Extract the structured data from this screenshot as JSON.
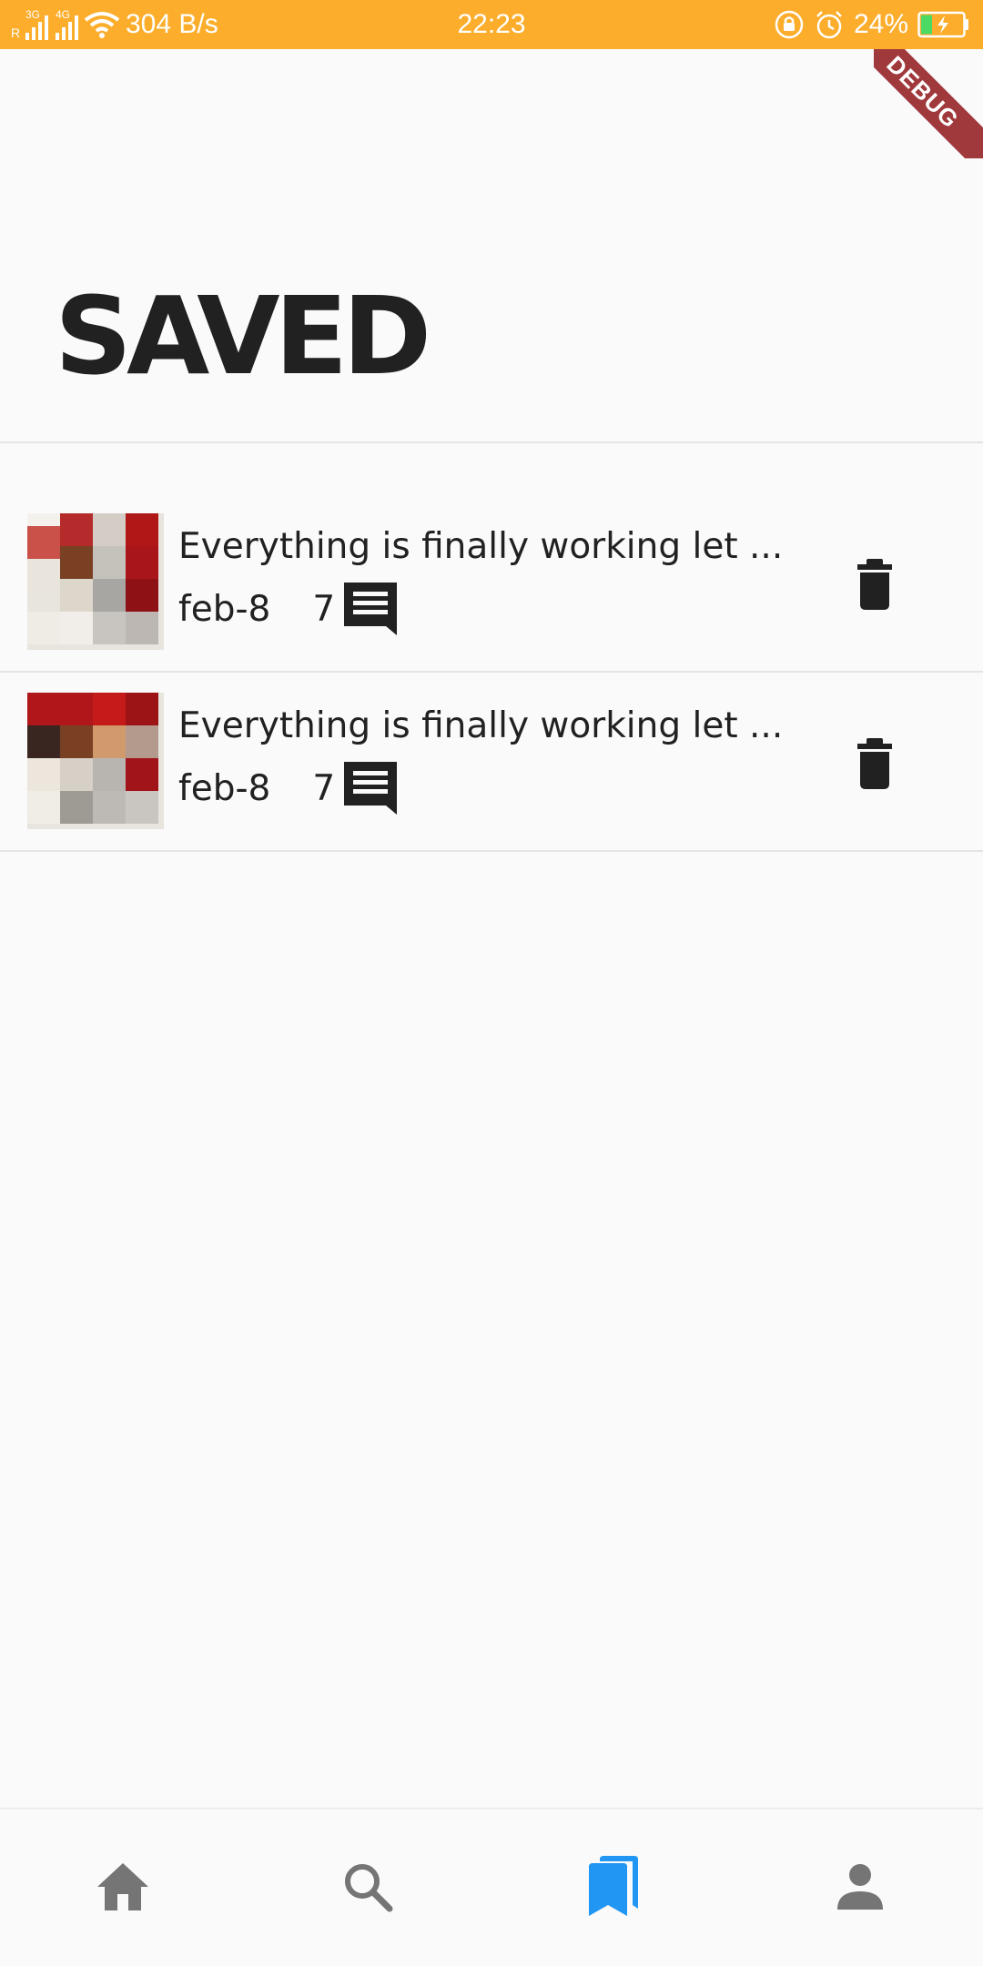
{
  "status_bar": {
    "network_speed": "304 B/s",
    "time": "22:23",
    "battery": "24%",
    "sim1_tag": "3G",
    "sim2_tag": "4G",
    "roaming": "R"
  },
  "debug_banner": {
    "label": "DEBUG"
  },
  "page": {
    "title": "SAVED"
  },
  "saved_items": [
    {
      "title": "Everything is finally working let ...",
      "date": "feb-8",
      "comment_count": "7"
    },
    {
      "title": "Everything is finally working let ...",
      "date": "feb-8",
      "comment_count": "7"
    }
  ],
  "bottom_nav": {
    "items": [
      {
        "name": "home",
        "icon": "home-icon",
        "active": false
      },
      {
        "name": "search",
        "icon": "search-icon",
        "active": false
      },
      {
        "name": "saved",
        "icon": "bookmarks-icon",
        "active": true
      },
      {
        "name": "profile",
        "icon": "person-icon",
        "active": false
      }
    ]
  },
  "colors": {
    "status_bar": "#fbad2b",
    "active_nav": "#2196f3",
    "inactive_nav": "#757575",
    "text": "#212121",
    "debug_ribbon": "#a0393c"
  }
}
